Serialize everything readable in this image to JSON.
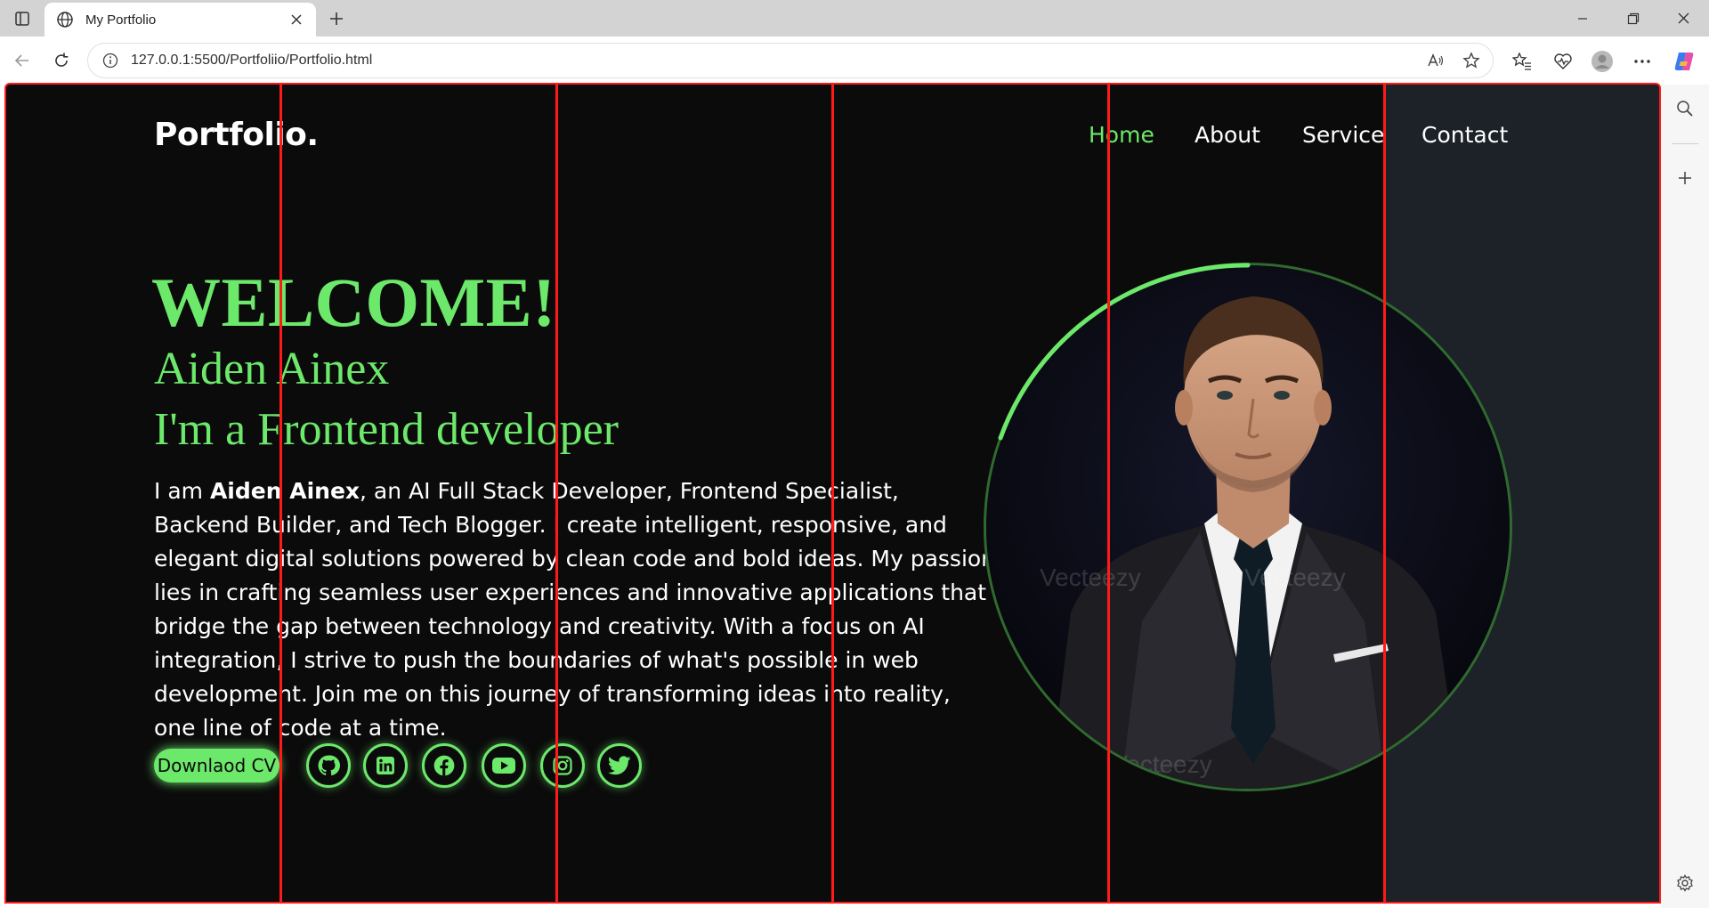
{
  "browser": {
    "tab_title": "My Portfolio",
    "url": "127.0.0.1:5500/Portfoliio/Portfolio.html"
  },
  "site": {
    "brand": "Portfolio.",
    "nav": [
      {
        "label": "Home",
        "active": true
      },
      {
        "label": "About",
        "active": false
      },
      {
        "label": "Service",
        "active": false
      },
      {
        "label": "Contact",
        "active": false
      }
    ],
    "hero": {
      "welcome": "WELCOME!",
      "name": "Aiden Ainex",
      "role": "I'm a Frontend developer",
      "bio_prefix": "I am ",
      "bio_name": "Aiden Ainex",
      "bio_rest": ", an AI Full Stack Developer, Frontend Specialist, Backend Builder, and Tech Blogger. I create intelligent, responsive, and elegant digital solutions powered by clean code and bold ideas. My passion lies in crafting seamless user experiences and innovative applications that bridge the gap between technology and creativity. With a focus on AI integration, I strive to push the boundaries of what's possible in web development. Join me on this journey of transforming ideas into reality, one line of code at a time.",
      "cv_button": "Downlaod CV",
      "socials": [
        "github-icon",
        "linkedin-icon",
        "facebook-icon",
        "youtube-icon",
        "instagram-icon",
        "twitter-icon"
      ],
      "photo_watermark": "Vecteezy"
    }
  },
  "colors": {
    "accent": "#6ce86a",
    "background": "#0b0b0b",
    "sidebar_zone": "#1d2229",
    "grid_lines": "#ff1a1a"
  }
}
